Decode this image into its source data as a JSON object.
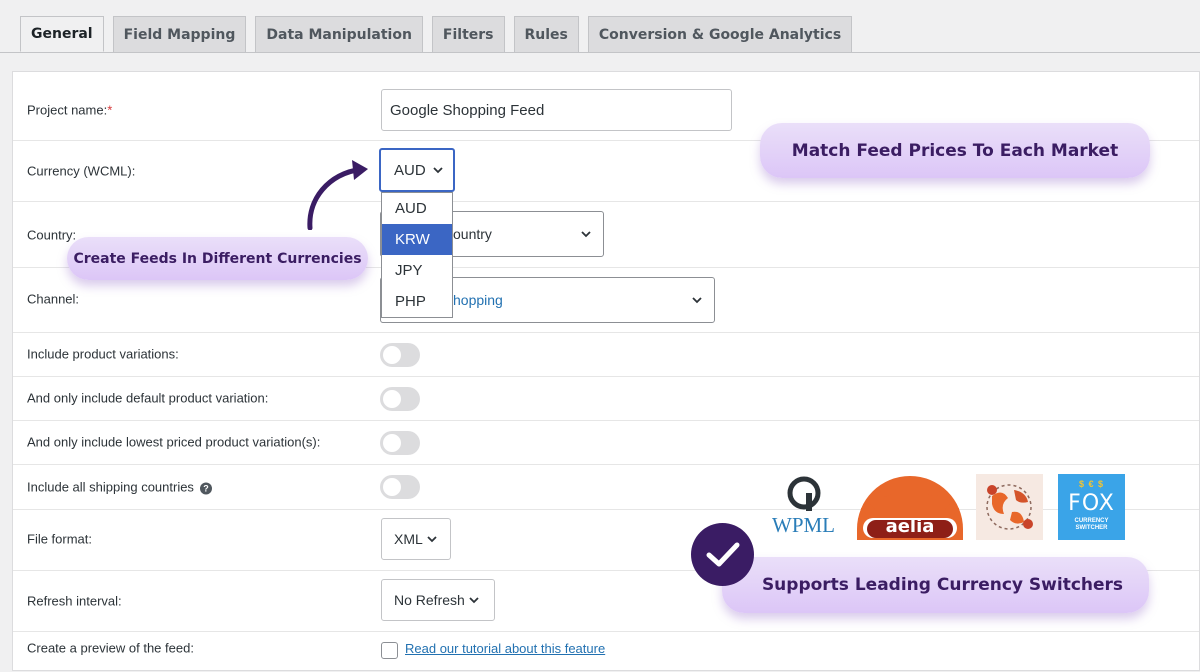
{
  "tabs": [
    {
      "label": "General",
      "active": true
    },
    {
      "label": "Field Mapping",
      "active": false
    },
    {
      "label": "Data Manipulation",
      "active": false
    },
    {
      "label": "Filters",
      "active": false
    },
    {
      "label": "Rules",
      "active": false
    },
    {
      "label": "Conversion & Google Analytics",
      "active": false
    }
  ],
  "form": {
    "project_name": {
      "label": "Project name:",
      "required_mark": "*",
      "value": "Google Shopping Feed"
    },
    "currency": {
      "label": "Currency (WCML):",
      "value": "AUD",
      "options": [
        "AUD",
        "KRW",
        "JPY",
        "PHP"
      ],
      "highlighted": "KRW"
    },
    "country": {
      "label": "Country:",
      "value_partial": "ountry"
    },
    "channel": {
      "label": "Channel:",
      "value_partial": "hopping"
    },
    "include_variations": {
      "label": "Include product variations:",
      "on": false
    },
    "default_variation": {
      "label": "And only include default product variation:",
      "on": false
    },
    "lowest_variation": {
      "label": "And only include lowest priced product variation(s):",
      "on": false
    },
    "shipping_countries": {
      "label": "Include all shipping countries",
      "help_icon": "?",
      "on": false
    },
    "file_format": {
      "label": "File format:",
      "value": "XML"
    },
    "refresh_interval": {
      "label": "Refresh interval:",
      "value": "No Refresh"
    },
    "preview": {
      "label": "Create a preview of the feed:",
      "link": "Read our tutorial about this feature"
    }
  },
  "promo": {
    "match_prices": "Match Feed Prices To Each Market",
    "different_currencies": "Create Feeds In Different Currencies",
    "supports": "Supports Leading Currency Switchers",
    "logos": {
      "wpml": "WPML",
      "aelia": "aelia",
      "fox": "FOX",
      "fox_sub": "CURRENCY SWITCHER",
      "fox_coins": "$ € $"
    }
  },
  "colors": {
    "accent": "#3b66c4",
    "pill_text": "#3b1d63",
    "check_bg": "#3a1c64",
    "aelia_orange": "#e8672a",
    "fox_blue": "#3aa4e8"
  }
}
